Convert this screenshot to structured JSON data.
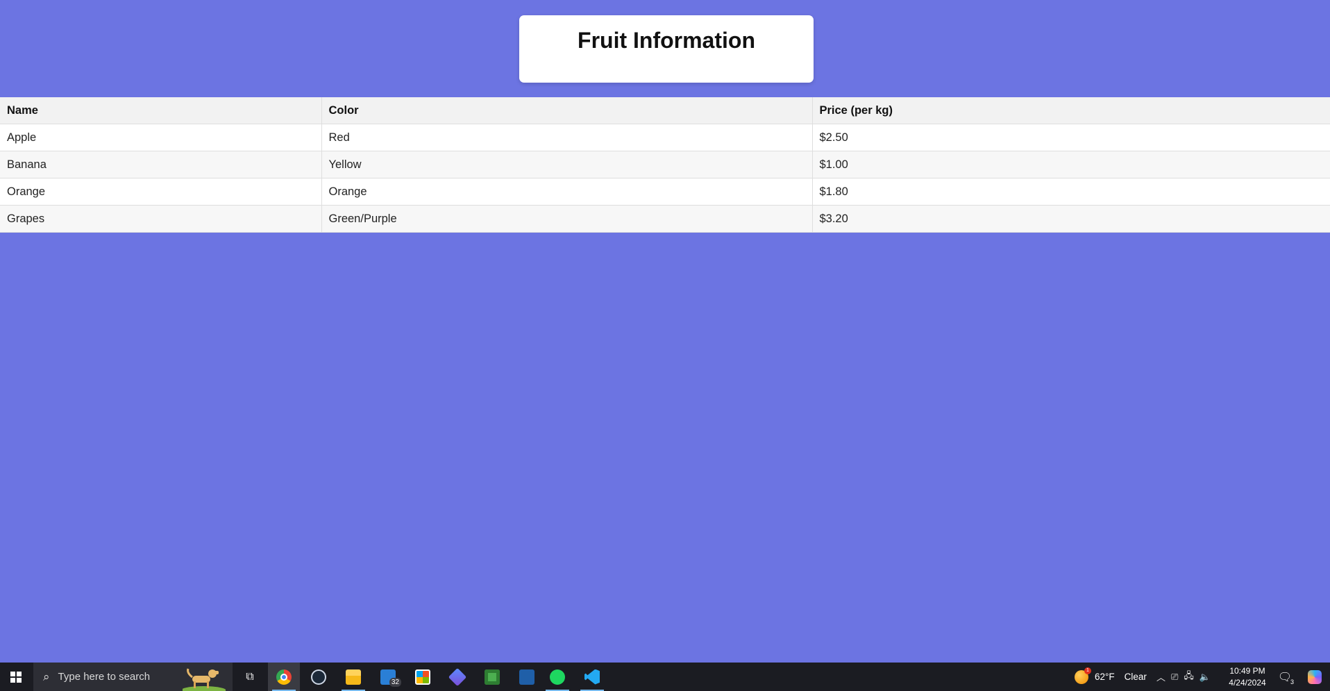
{
  "page": {
    "title": "Fruit Information",
    "background_color": "#6c74e2"
  },
  "table": {
    "headers": [
      "Name",
      "Color",
      "Price (per kg)"
    ],
    "rows": [
      [
        "Apple",
        "Red",
        "$2.50"
      ],
      [
        "Banana",
        "Yellow",
        "$1.00"
      ],
      [
        "Orange",
        "Orange",
        "$1.80"
      ],
      [
        "Grapes",
        "Green/Purple",
        "$3.20"
      ]
    ]
  },
  "taskbar": {
    "search_placeholder": "Type here to search",
    "apps": [
      {
        "name": "task-view-icon",
        "active": false
      },
      {
        "name": "chrome-icon",
        "active": true
      },
      {
        "name": "steam-icon",
        "active": false
      },
      {
        "name": "file-explorer-icon",
        "active": true
      },
      {
        "name": "mail-icon",
        "active": false,
        "badge": "32"
      },
      {
        "name": "microsoft-store-icon",
        "active": false
      },
      {
        "name": "copilot-app-icon",
        "active": false
      },
      {
        "name": "minecraft-icon",
        "active": false
      },
      {
        "name": "app-icon",
        "active": false
      },
      {
        "name": "spotify-icon",
        "active": true
      },
      {
        "name": "vscode-icon",
        "active": true
      }
    ],
    "mail_badge": "32",
    "weather": {
      "alert_count": "1",
      "temperature": "62°F",
      "condition": "Clear"
    },
    "clock": {
      "time": "10:49 PM",
      "date": "4/24/2024"
    },
    "notifications_count": "3",
    "colors": {
      "background": "#1b1c22",
      "active_indicator": "#76b9ed"
    }
  }
}
